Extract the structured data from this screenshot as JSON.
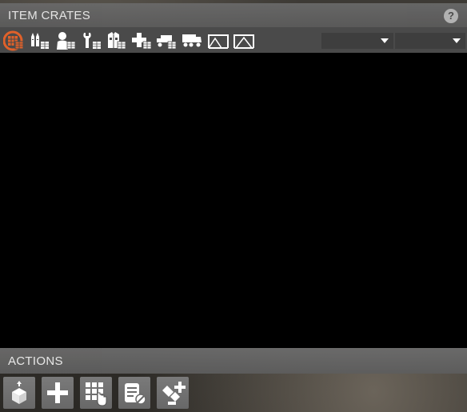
{
  "panel": {
    "title": "ITEM CRATES",
    "help_label": "?"
  },
  "toolbar": {
    "filters": [
      {
        "icon": "crate-grid-icon",
        "active": true
      },
      {
        "icon": "ammunition-icon",
        "active": false
      },
      {
        "icon": "soldier-icon",
        "active": false
      },
      {
        "icon": "wrench-icon",
        "active": false
      },
      {
        "icon": "uniform-icon",
        "active": false
      },
      {
        "icon": "medical-cross-icon",
        "active": false
      },
      {
        "icon": "truck-icon",
        "active": false
      },
      {
        "icon": "heavy-truck-icon",
        "active": false
      },
      {
        "icon": "shelter-icon",
        "active": false
      },
      {
        "icon": "tent-icon",
        "active": false
      }
    ],
    "dropdown_1": {
      "value": ""
    },
    "dropdown_2": {
      "value": ""
    }
  },
  "actions": {
    "title": "ACTIONS",
    "buttons": [
      {
        "icon": "place-crate-icon"
      },
      {
        "icon": "add-icon"
      },
      {
        "icon": "grid-select-icon"
      },
      {
        "icon": "manifest-icon"
      },
      {
        "icon": "satellite-add-icon"
      }
    ]
  },
  "colors": {
    "accent": "#e0612a",
    "header": "#626262",
    "toolbar": "#4a4a4a",
    "content": "#000000"
  }
}
